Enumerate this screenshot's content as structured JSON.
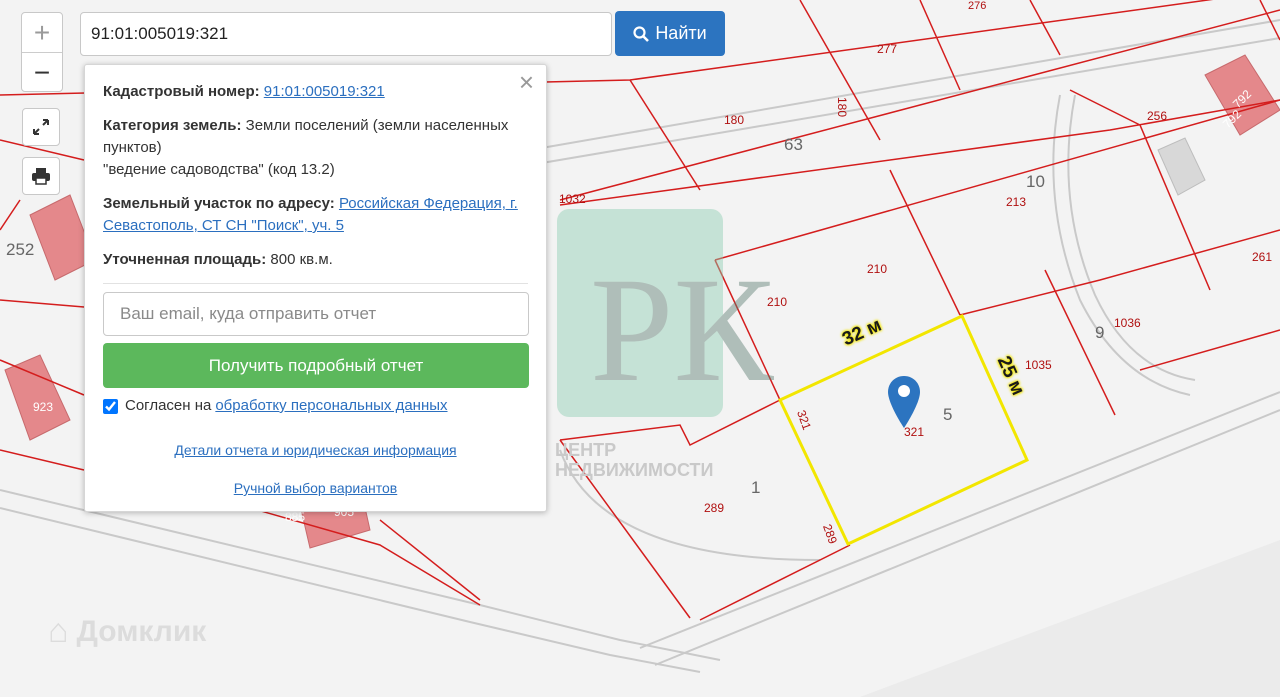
{
  "map": {
    "parcel_labels": [
      "276",
      "277",
      "180",
      "180",
      "63",
      "256",
      "792",
      "792",
      "10",
      "213",
      "1032",
      "252",
      "210",
      "210",
      "261",
      "9",
      "1036",
      "1035",
      "5",
      "321",
      "321",
      "1",
      "289",
      "289",
      "923",
      "885",
      "905"
    ],
    "dimensions": {
      "width": "32 м",
      "height": "25 м"
    },
    "watermark_logo_letters": "РК",
    "watermark_caption_1": "ЦЕНТР",
    "watermark_caption_2": "НЕДВИЖИМОСТИ",
    "brand_watermark": "Домклик",
    "colors": {
      "parcel_border": "#d41d1d",
      "highlight": "#f2e600",
      "marker": "#2c74c0",
      "building": "#e4888b"
    }
  },
  "controls": {
    "zoom_in": "+",
    "zoom_out": "−",
    "fullscreen_icon": "fullscreen-icon",
    "print_icon": "print-icon"
  },
  "search": {
    "value": "91:01:005019:321",
    "button_label": "Найти",
    "button_icon": "search-icon"
  },
  "popup": {
    "cad_label": "Кадастровый номер:",
    "cad_value": "91:01:005019:321",
    "cat_label": "Категория земель:",
    "cat_value_1": "Земли поселений (земли населенных пунктов)",
    "cat_value_2": "\"ведение садоводства\" (код 13.2)",
    "addr_label": "Земельный участок по адресу:",
    "addr_value": "Российская Федерация, г. Севастополь, СТ СН \"Поиск\", уч. 5",
    "area_label": "Уточненная площадь:",
    "area_value": "800 кв.м.",
    "email_placeholder": "Ваш email, куда отправить отчет",
    "report_button": "Получить подробный отчет",
    "agree_text": "Согласен на",
    "agree_link": "обработку персональных данных",
    "agree_checked": true,
    "details_link": "Детали отчета и юридическая информация",
    "manual_link": "Ручной выбор вариантов",
    "close_label": "×"
  }
}
